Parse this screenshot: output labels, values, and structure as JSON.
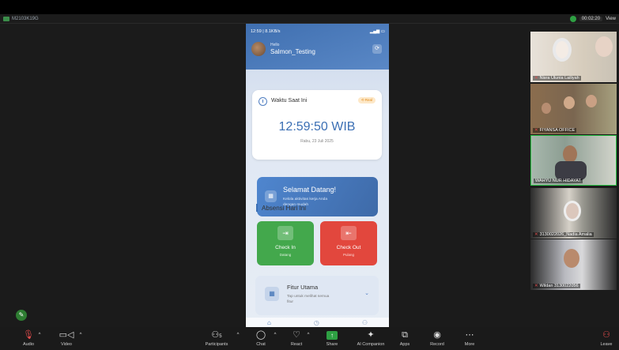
{
  "window": {
    "title": "M2103K19G"
  },
  "zoom_header": {
    "timer": "00:02:20",
    "view_label": "View"
  },
  "phone": {
    "status_bar": "12:59 | 8.1KB/s",
    "hello": "Hello",
    "username": "Salmon_Testing",
    "time_card": {
      "label": "Waktu Saat Ini",
      "badge": "Real",
      "time": "12:59:50 WIB",
      "date": "Rabu, 23 Juli 2025"
    },
    "welcome": {
      "title": "Selamat Datang!",
      "subtitle": "Kelola aktivitas kerja Anda dengan mudah"
    },
    "section_title": "Absensi Hari Ini",
    "check_in": {
      "label": "Check In",
      "sub": "Datang"
    },
    "check_out": {
      "label": "Check Out",
      "sub": "Pulang"
    },
    "fitur": {
      "title": "Fitur Utama",
      "subtitle": "Tap untuk melihat semua fitur"
    }
  },
  "participants_tiles": [
    {
      "name": "Nisra Ulunia Lailiyah"
    },
    {
      "name": "FIYANSA OFFICE"
    },
    {
      "name": "WAHYU NUR HIDAYAT"
    },
    {
      "name": "3130022026_Nadia Amalia"
    },
    {
      "name": "Wildan 3130022056"
    }
  ],
  "toolbar": {
    "audio": "Audio",
    "video": "Video",
    "participants": "Participants",
    "participants_count": "5",
    "chat": "Chat",
    "react": "React",
    "share": "Share",
    "ai_companion": "AI Companion",
    "apps": "Apps",
    "record": "Record",
    "more": "More",
    "leave": "Leave"
  },
  "colors": {
    "accent": "#3b6fb4",
    "check_in": "#43a84c",
    "check_out": "#e2473d",
    "share": "#2ea043",
    "leave": "#e24c4c",
    "active_border": "#29c043"
  }
}
